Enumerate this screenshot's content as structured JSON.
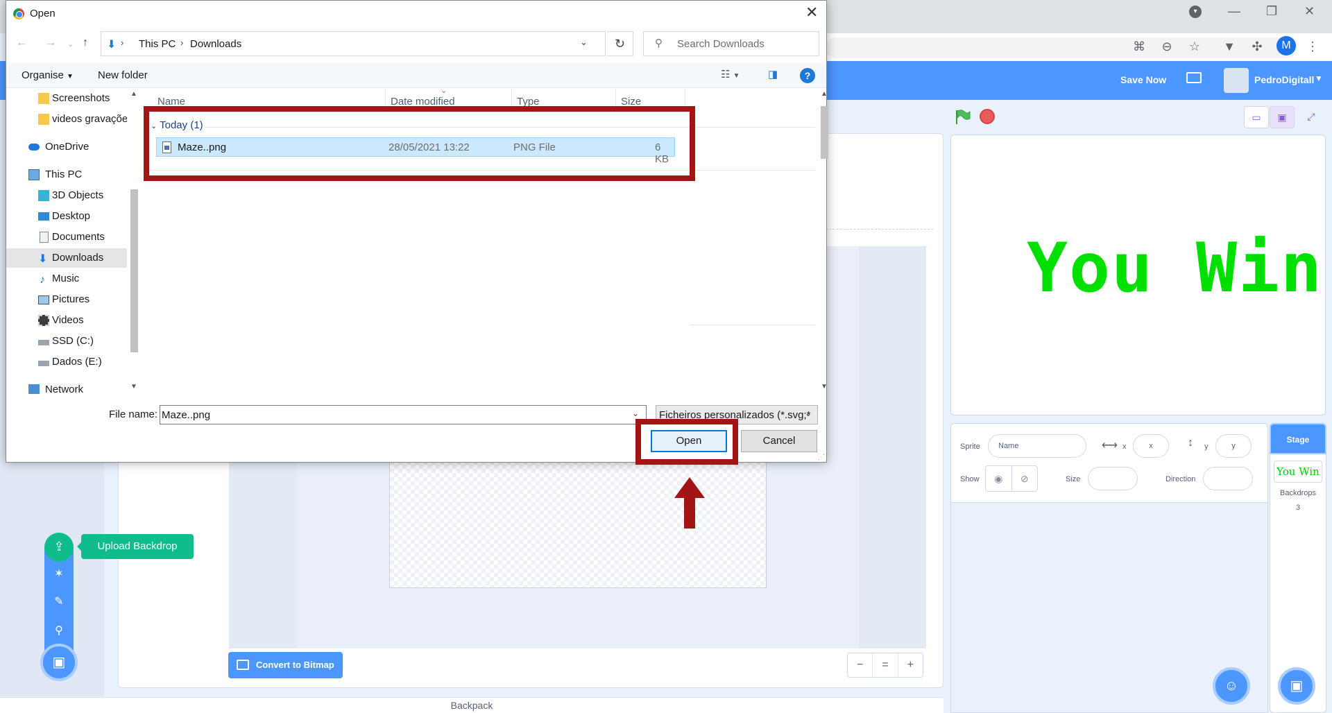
{
  "chrome": {
    "profile_initial": "M",
    "window_controls": [
      "—",
      "❐",
      "✕"
    ]
  },
  "scratch": {
    "save_now": "Save Now",
    "username": "PedroDigitall",
    "convert_button": "Convert to Bitmap",
    "upload_tooltip": "Upload Backdrop",
    "backpack": "Backpack",
    "stage_text": "You Win",
    "sprite_label": "Sprite",
    "name_placeholder": "Name",
    "x_label": "x",
    "x_placeholder": "x",
    "y_label": "y",
    "y_placeholder": "y",
    "show_label": "Show",
    "size_label": "Size",
    "direction_label": "Direction",
    "stage_panel_title": "Stage",
    "stage_thumb_text": "You Win",
    "backdrops_label": "Backdrops",
    "backdrops_count": "3",
    "zoom": {
      "out": "−",
      "reset": "=",
      "in": "+"
    }
  },
  "dialog": {
    "title": "Open",
    "breadcrumb": [
      "This PC",
      "Downloads"
    ],
    "search_placeholder": "Search Downloads",
    "organise": "Organise",
    "new_folder": "New folder",
    "help": "?",
    "nav_tree": [
      {
        "label": "Screenshots",
        "icon": "folder-icon"
      },
      {
        "label": "videos gravaçõe",
        "icon": "folder-icon"
      },
      {
        "label": "OneDrive",
        "icon": "cloud-icon"
      },
      {
        "label": "This PC",
        "icon": "pc-icon"
      },
      {
        "label": "3D Objects",
        "icon": "3d-icon"
      },
      {
        "label": "Desktop",
        "icon": "desktop-icon"
      },
      {
        "label": "Documents",
        "icon": "documents-icon"
      },
      {
        "label": "Downloads",
        "icon": "download-icon",
        "selected": true
      },
      {
        "label": "Music",
        "icon": "music-icon"
      },
      {
        "label": "Pictures",
        "icon": "pictures-icon"
      },
      {
        "label": "Videos",
        "icon": "video-icon"
      },
      {
        "label": "SSD (C:)",
        "icon": "drive-icon"
      },
      {
        "label": "Dados (E:)",
        "icon": "drive-icon"
      },
      {
        "label": "Network",
        "icon": "network-icon"
      }
    ],
    "columns": [
      "Name",
      "Date modified",
      "Type",
      "Size"
    ],
    "group": "Today (1)",
    "files": [
      {
        "name": "Maze..png",
        "date": "28/05/2021 13:22",
        "type": "PNG File",
        "size": "6 KB"
      }
    ],
    "file_name_label": "File name:",
    "file_name_value": "Maze..png",
    "file_type_filter": "Ficheiros personalizados (*.svg;*",
    "open_button": "Open",
    "cancel_button": "Cancel",
    "highlight_color": "#a31515"
  }
}
